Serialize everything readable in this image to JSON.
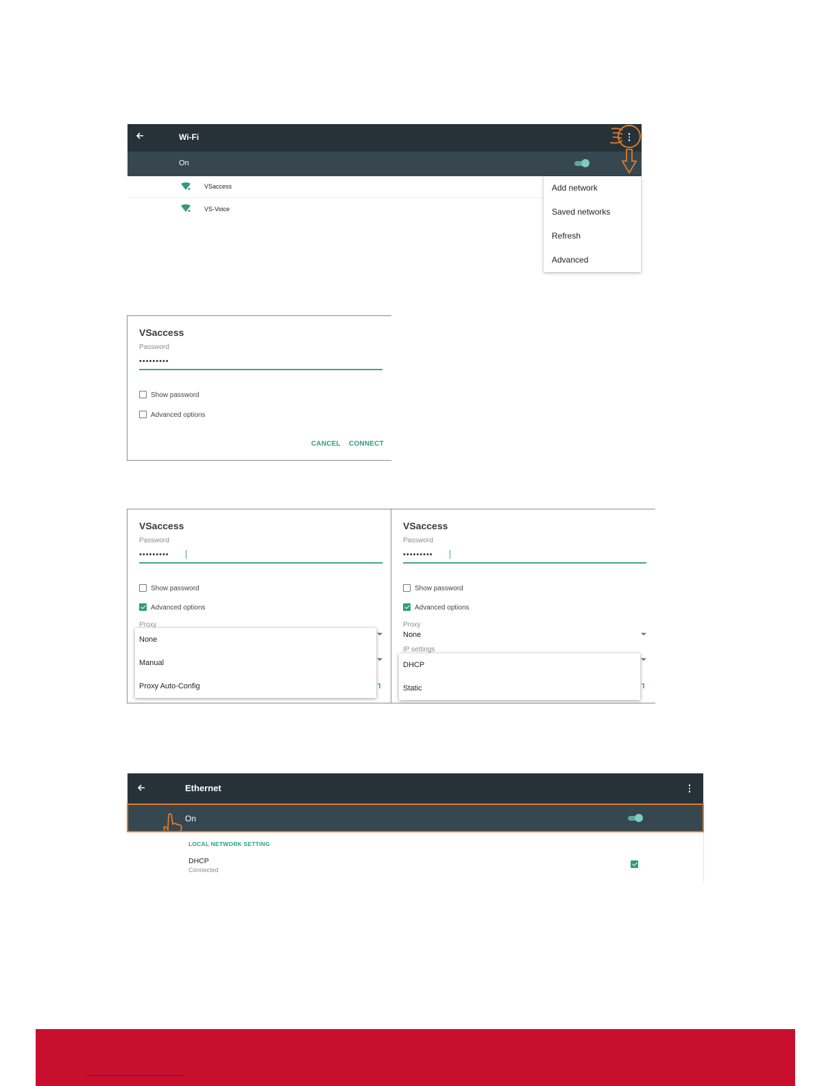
{
  "wifi": {
    "title": "Wi-Fi",
    "status": "On",
    "networks": [
      "VSaccess",
      "VS-Voice"
    ],
    "menu": [
      "Add network",
      "Saved networks",
      "Refresh",
      "Advanced"
    ]
  },
  "dialog_single": {
    "title": "VSaccess",
    "password_label": "Password",
    "password_value": "•••••••••",
    "show_password": "Show password",
    "advanced_options": "Advanced options",
    "cancel": "CANCEL",
    "connect": "CONNECT"
  },
  "dialog_proxy": {
    "title": "VSaccess",
    "password_label": "Password",
    "password_value": "•••••••••",
    "show_password": "Show password",
    "advanced_options": "Advanced options",
    "proxy_label": "Proxy",
    "options": [
      "None",
      "Manual",
      "Proxy Auto-Config"
    ]
  },
  "dialog_ip": {
    "title": "VSaccess",
    "password_label": "Password",
    "password_value": "•••••••••",
    "show_password": "Show password",
    "advanced_options": "Advanced options",
    "proxy_label": "Proxy",
    "proxy_value": "None",
    "ip_label": "IP settings",
    "options": [
      "DHCP",
      "Static"
    ]
  },
  "ethernet": {
    "title": "Ethernet",
    "status": "On",
    "section": "LOCAL NETWORK SETTING",
    "item_title": "DHCP",
    "item_sub": "Connected"
  },
  "colors": {
    "appbar": "#263238",
    "subbar": "#37474f",
    "accent": "#2e9d7d",
    "annotation": "#e07b2c",
    "footer": "#c8102e"
  },
  "icons": [
    "back-arrow-icon",
    "more-vert-icon",
    "wifi-icon",
    "toggle-switch",
    "checkbox-icon",
    "dropdown-caret-icon",
    "pointing-hand-icon"
  ]
}
